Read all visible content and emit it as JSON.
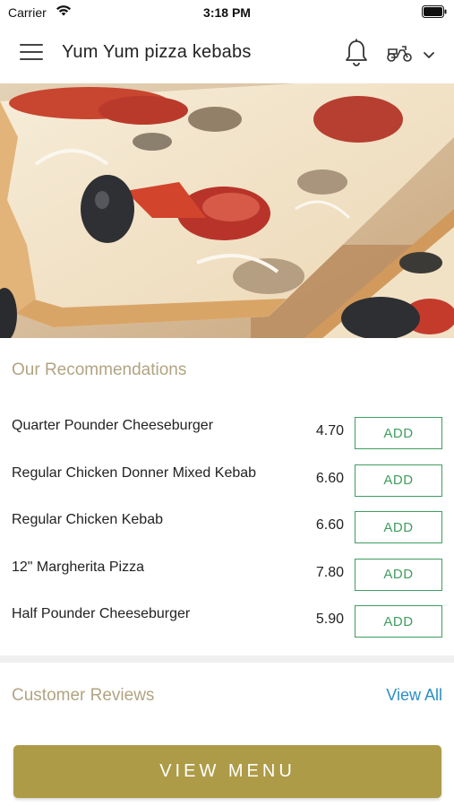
{
  "status_bar": {
    "carrier": "Carrier",
    "time": "3:18 PM"
  },
  "header": {
    "title": "Yum Yum pizza kebabs",
    "icons": [
      "menu-icon",
      "bell-icon",
      "delivery-scooter-icon",
      "chevron-down-icon"
    ]
  },
  "hero": {
    "image": "pizza-photo"
  },
  "recommendations": {
    "title": "Our Recommendations",
    "items": [
      {
        "name": "Quarter Pounder Cheeseburger",
        "price": "4.70",
        "action": "ADD"
      },
      {
        "name": "Regular Chicken Donner Mixed Kebab",
        "price": "6.60",
        "action": "ADD"
      },
      {
        "name": "Regular Chicken Kebab",
        "price": "6.60",
        "action": "ADD"
      },
      {
        "name": "12\" Margherita Pizza",
        "price": "7.80",
        "action": "ADD"
      },
      {
        "name": "Half Pounder Cheeseburger",
        "price": "5.90",
        "action": "ADD"
      }
    ]
  },
  "reviews": {
    "title": "Customer Reviews",
    "view_all": "View All"
  },
  "footer": {
    "view_menu": "VIEW MENU"
  },
  "colors": {
    "accent_gold": "#ad9b47",
    "section_title": "#b2a482",
    "add_green": "#3e9e5f",
    "link_blue": "#2a8fc4"
  }
}
